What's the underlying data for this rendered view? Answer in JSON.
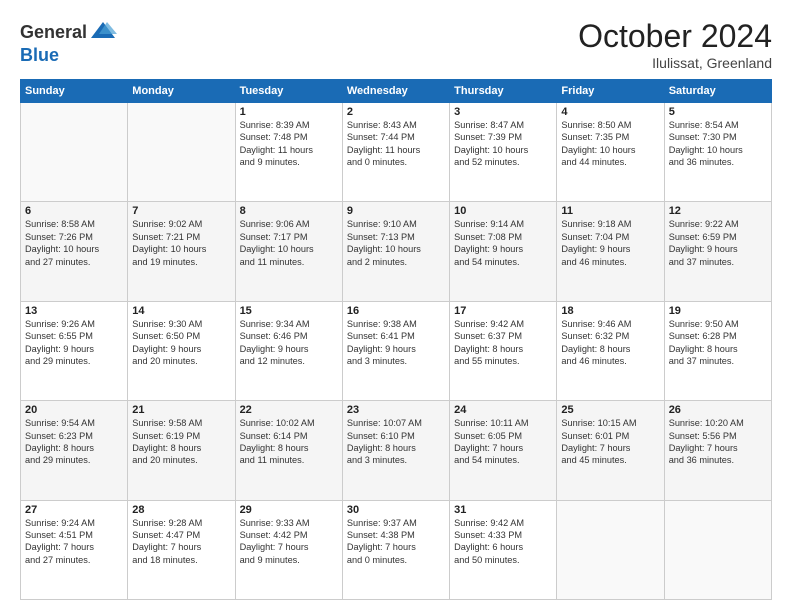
{
  "logo": {
    "general": "General",
    "blue": "Blue"
  },
  "title": "October 2024",
  "location": "Ilulissat, Greenland",
  "weekdays": [
    "Sunday",
    "Monday",
    "Tuesday",
    "Wednesday",
    "Thursday",
    "Friday",
    "Saturday"
  ],
  "weeks": [
    [
      {
        "day": "",
        "content": ""
      },
      {
        "day": "",
        "content": ""
      },
      {
        "day": "1",
        "content": "Sunrise: 8:39 AM\nSunset: 7:48 PM\nDaylight: 11 hours\nand 9 minutes."
      },
      {
        "day": "2",
        "content": "Sunrise: 8:43 AM\nSunset: 7:44 PM\nDaylight: 11 hours\nand 0 minutes."
      },
      {
        "day": "3",
        "content": "Sunrise: 8:47 AM\nSunset: 7:39 PM\nDaylight: 10 hours\nand 52 minutes."
      },
      {
        "day": "4",
        "content": "Sunrise: 8:50 AM\nSunset: 7:35 PM\nDaylight: 10 hours\nand 44 minutes."
      },
      {
        "day": "5",
        "content": "Sunrise: 8:54 AM\nSunset: 7:30 PM\nDaylight: 10 hours\nand 36 minutes."
      }
    ],
    [
      {
        "day": "6",
        "content": "Sunrise: 8:58 AM\nSunset: 7:26 PM\nDaylight: 10 hours\nand 27 minutes."
      },
      {
        "day": "7",
        "content": "Sunrise: 9:02 AM\nSunset: 7:21 PM\nDaylight: 10 hours\nand 19 minutes."
      },
      {
        "day": "8",
        "content": "Sunrise: 9:06 AM\nSunset: 7:17 PM\nDaylight: 10 hours\nand 11 minutes."
      },
      {
        "day": "9",
        "content": "Sunrise: 9:10 AM\nSunset: 7:13 PM\nDaylight: 10 hours\nand 2 minutes."
      },
      {
        "day": "10",
        "content": "Sunrise: 9:14 AM\nSunset: 7:08 PM\nDaylight: 9 hours\nand 54 minutes."
      },
      {
        "day": "11",
        "content": "Sunrise: 9:18 AM\nSunset: 7:04 PM\nDaylight: 9 hours\nand 46 minutes."
      },
      {
        "day": "12",
        "content": "Sunrise: 9:22 AM\nSunset: 6:59 PM\nDaylight: 9 hours\nand 37 minutes."
      }
    ],
    [
      {
        "day": "13",
        "content": "Sunrise: 9:26 AM\nSunset: 6:55 PM\nDaylight: 9 hours\nand 29 minutes."
      },
      {
        "day": "14",
        "content": "Sunrise: 9:30 AM\nSunset: 6:50 PM\nDaylight: 9 hours\nand 20 minutes."
      },
      {
        "day": "15",
        "content": "Sunrise: 9:34 AM\nSunset: 6:46 PM\nDaylight: 9 hours\nand 12 minutes."
      },
      {
        "day": "16",
        "content": "Sunrise: 9:38 AM\nSunset: 6:41 PM\nDaylight: 9 hours\nand 3 minutes."
      },
      {
        "day": "17",
        "content": "Sunrise: 9:42 AM\nSunset: 6:37 PM\nDaylight: 8 hours\nand 55 minutes."
      },
      {
        "day": "18",
        "content": "Sunrise: 9:46 AM\nSunset: 6:32 PM\nDaylight: 8 hours\nand 46 minutes."
      },
      {
        "day": "19",
        "content": "Sunrise: 9:50 AM\nSunset: 6:28 PM\nDaylight: 8 hours\nand 37 minutes."
      }
    ],
    [
      {
        "day": "20",
        "content": "Sunrise: 9:54 AM\nSunset: 6:23 PM\nDaylight: 8 hours\nand 29 minutes."
      },
      {
        "day": "21",
        "content": "Sunrise: 9:58 AM\nSunset: 6:19 PM\nDaylight: 8 hours\nand 20 minutes."
      },
      {
        "day": "22",
        "content": "Sunrise: 10:02 AM\nSunset: 6:14 PM\nDaylight: 8 hours\nand 11 minutes."
      },
      {
        "day": "23",
        "content": "Sunrise: 10:07 AM\nSunset: 6:10 PM\nDaylight: 8 hours\nand 3 minutes."
      },
      {
        "day": "24",
        "content": "Sunrise: 10:11 AM\nSunset: 6:05 PM\nDaylight: 7 hours\nand 54 minutes."
      },
      {
        "day": "25",
        "content": "Sunrise: 10:15 AM\nSunset: 6:01 PM\nDaylight: 7 hours\nand 45 minutes."
      },
      {
        "day": "26",
        "content": "Sunrise: 10:20 AM\nSunset: 5:56 PM\nDaylight: 7 hours\nand 36 minutes."
      }
    ],
    [
      {
        "day": "27",
        "content": "Sunrise: 9:24 AM\nSunset: 4:51 PM\nDaylight: 7 hours\nand 27 minutes."
      },
      {
        "day": "28",
        "content": "Sunrise: 9:28 AM\nSunset: 4:47 PM\nDaylight: 7 hours\nand 18 minutes."
      },
      {
        "day": "29",
        "content": "Sunrise: 9:33 AM\nSunset: 4:42 PM\nDaylight: 7 hours\nand 9 minutes."
      },
      {
        "day": "30",
        "content": "Sunrise: 9:37 AM\nSunset: 4:38 PM\nDaylight: 7 hours\nand 0 minutes."
      },
      {
        "day": "31",
        "content": "Sunrise: 9:42 AM\nSunset: 4:33 PM\nDaylight: 6 hours\nand 50 minutes."
      },
      {
        "day": "",
        "content": ""
      },
      {
        "day": "",
        "content": ""
      }
    ]
  ]
}
